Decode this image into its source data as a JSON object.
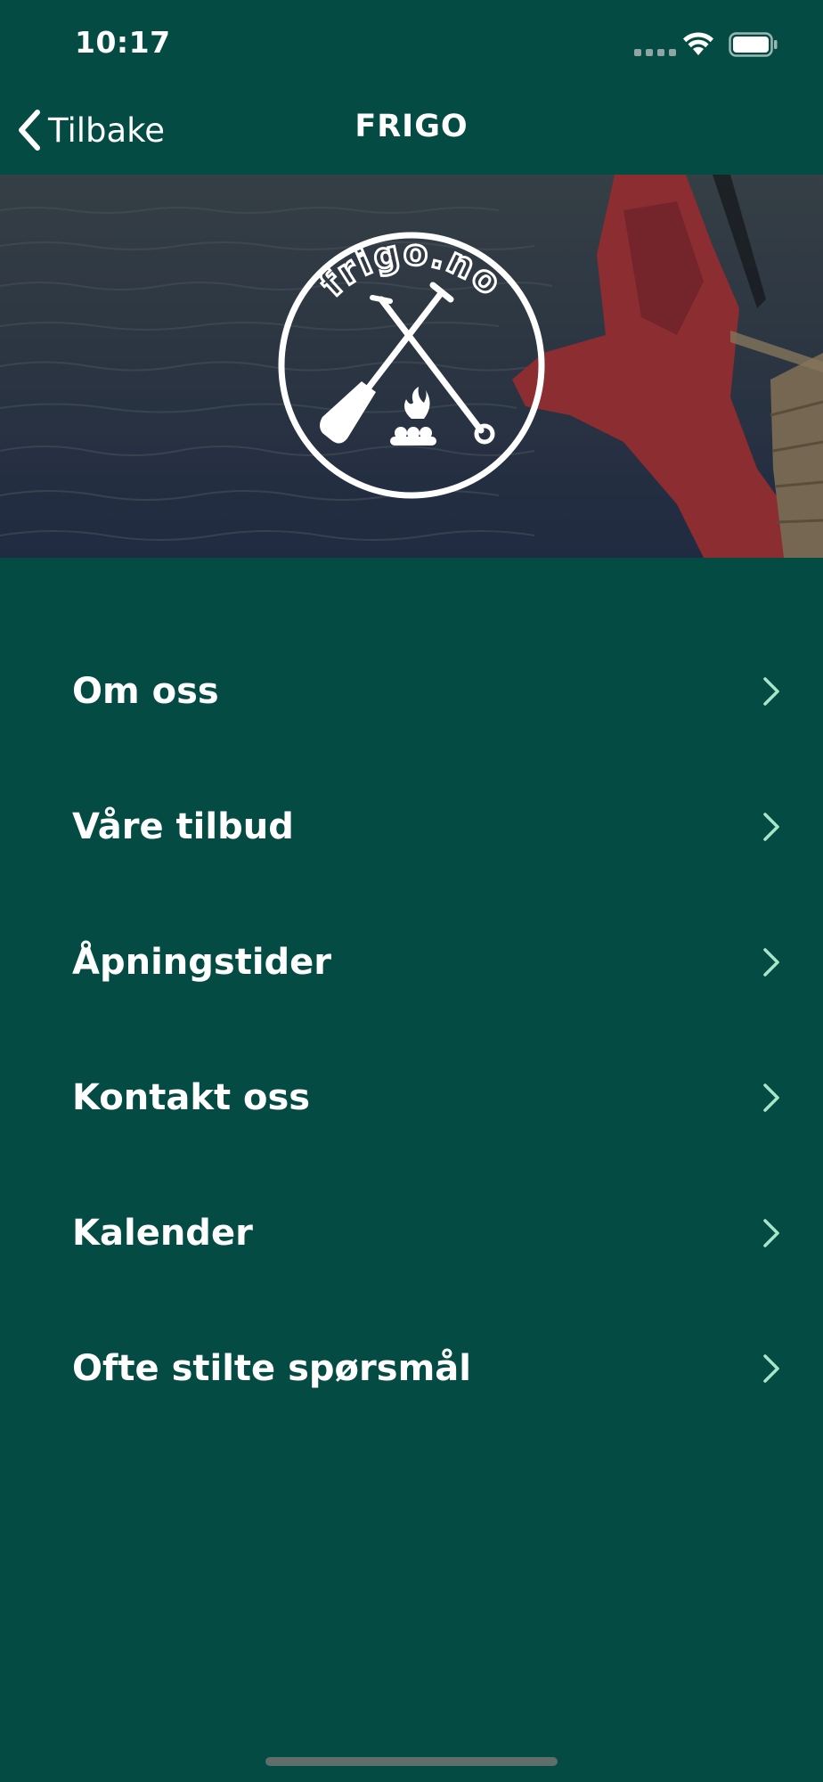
{
  "status_bar": {
    "time": "10:17"
  },
  "nav": {
    "back_label": "Tilbake",
    "title": "FRIGO"
  },
  "hero": {
    "logo_text": "frigo.no"
  },
  "menu": {
    "items": [
      {
        "label": "Om oss"
      },
      {
        "label": "Våre tilbud"
      },
      {
        "label": "Åpningstider"
      },
      {
        "label": "Kontakt oss"
      },
      {
        "label": "Kalender"
      },
      {
        "label": "Ofte stilte spørsmål"
      }
    ]
  },
  "colors": {
    "background": "#034b43",
    "chevron_accent": "#a8e6c9",
    "text": "#ffffff"
  }
}
